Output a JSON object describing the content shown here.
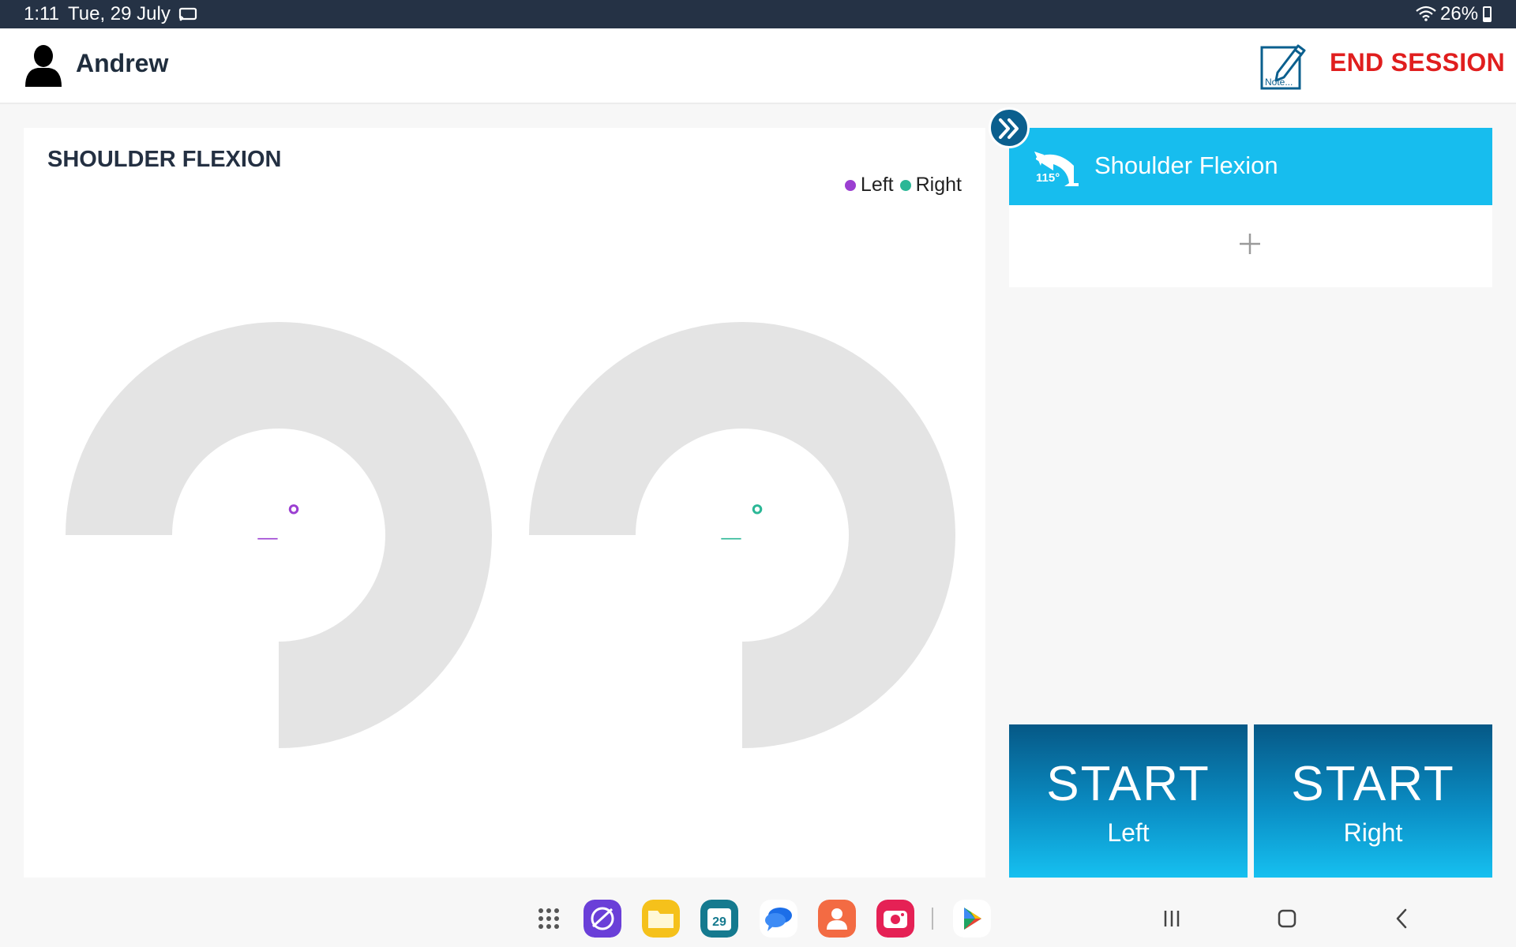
{
  "status_bar": {
    "time": "1:11",
    "date": "Tue, 29 July",
    "battery": "26%",
    "icons": [
      "cast-icon",
      "wifi-icon",
      "battery-icon"
    ]
  },
  "header": {
    "user_name": "Andrew",
    "note_label": "Note...",
    "end_session_label": "END SESSION"
  },
  "chart": {
    "title": "SHOULDER FLEXION",
    "legend": [
      {
        "label": "Left",
        "color": "#9b3fd1"
      },
      {
        "label": "Right",
        "color": "#2bb796"
      }
    ],
    "gauges": [
      {
        "side": "Left",
        "value_text": "_",
        "degree_symbol": "°",
        "color": "#9b3fd1"
      },
      {
        "side": "Right",
        "value_text": "_",
        "degree_symbol": "°",
        "color": "#2bb796"
      }
    ],
    "track_color": "#e4e4e4"
  },
  "exercises": {
    "active": {
      "name": "Shoulder Flexion",
      "icon_label": "115°"
    },
    "add_label": "+"
  },
  "start_buttons": [
    {
      "label": "START",
      "side": "Left"
    },
    {
      "label": "START",
      "side": "Right"
    }
  ],
  "dock": {
    "calendar_day": "29",
    "apps": [
      "apps-grid-icon",
      "internet-icon",
      "files-icon",
      "calendar-icon",
      "messages-icon",
      "contacts-icon",
      "camera-icon",
      "play-store-icon"
    ]
  },
  "colors": {
    "accent": "#17bdee",
    "dark_blue": "#0b5f8e",
    "danger": "#e01e1e",
    "status_bar": "#253245"
  }
}
